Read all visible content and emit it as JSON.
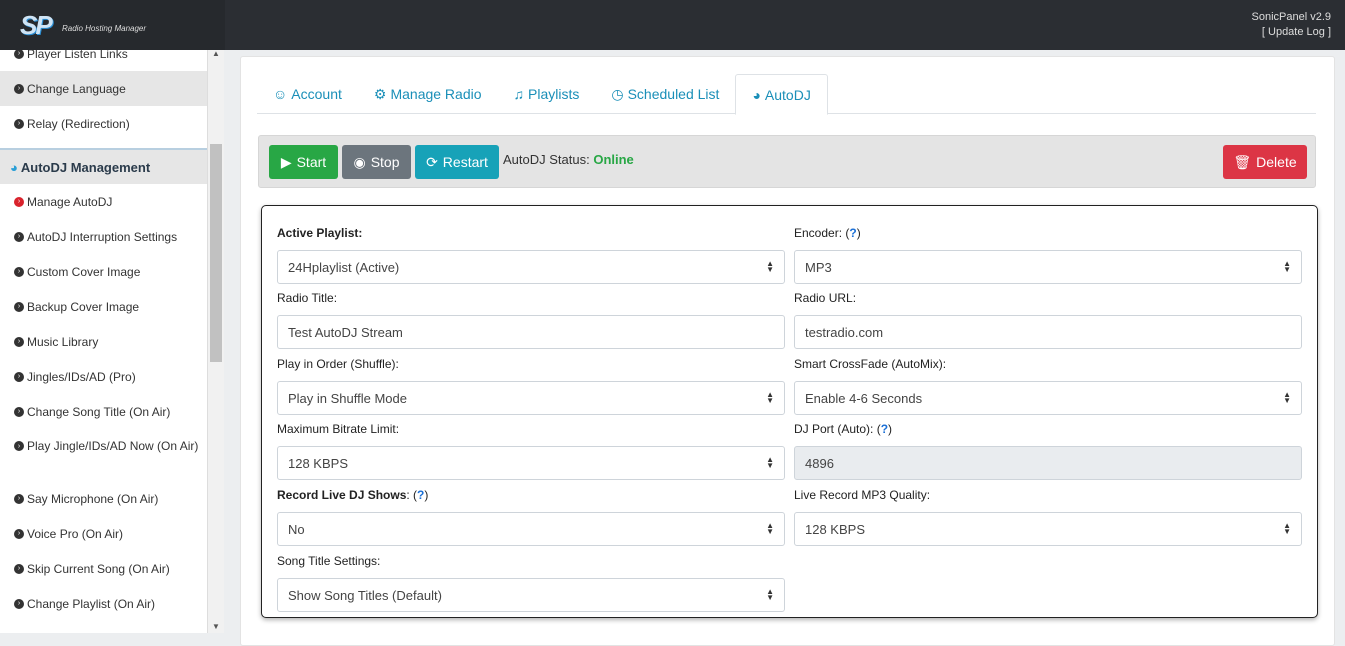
{
  "header": {
    "logo_text": "SP",
    "logo_subtitle": "Radio Hosting Manager",
    "version": "SonicPanel v2.9",
    "update_log": "[ Update Log ]"
  },
  "sidebar": {
    "items_top": [
      {
        "label": "Player Listen Links"
      },
      {
        "label": "Change Language"
      },
      {
        "label": "Relay (Redirection)"
      }
    ],
    "section": "AutoDJ Management",
    "items": [
      {
        "label": "Manage AutoDJ",
        "active": true
      },
      {
        "label": "AutoDJ Interruption Settings"
      },
      {
        "label": "Custom Cover Image"
      },
      {
        "label": "Backup Cover Image"
      },
      {
        "label": "Music Library"
      },
      {
        "label": "Jingles/IDs/AD (Pro)"
      },
      {
        "label": "Change Song Title (On Air)"
      },
      {
        "label": "Play Jingle/IDs/AD Now (On Air)"
      },
      {
        "label": "Say Microphone (On Air)"
      },
      {
        "label": "Voice Pro (On Air)"
      },
      {
        "label": "Skip Current Song (On Air)"
      },
      {
        "label": "Change Playlist (On Air)"
      }
    ]
  },
  "tabs": [
    {
      "label": "Account",
      "icon": "user-circle-icon"
    },
    {
      "label": "Manage Radio",
      "icon": "gear-icon"
    },
    {
      "label": "Playlists",
      "icon": "music-icon"
    },
    {
      "label": "Scheduled List",
      "icon": "clock-icon"
    },
    {
      "label": "AutoDJ",
      "icon": "headphones-icon",
      "active": true
    }
  ],
  "actions": {
    "start": "Start",
    "stop": "Stop",
    "restart": "Restart",
    "delete": "Delete",
    "status_label": "AutoDJ Status:",
    "status_value": "Online"
  },
  "colors": {
    "start": "#28a745",
    "stop": "#6c757d",
    "restart": "#17a2b8",
    "delete": "#dc3545",
    "online": "#28a745",
    "tab": "#1a8fb8"
  },
  "form": {
    "active_playlist": {
      "label": "Active Playlist",
      "value": "24Hplaylist (Active)"
    },
    "encoder": {
      "label": "Encoder:",
      "value": "MP3"
    },
    "radio_title": {
      "label": "Radio Title:",
      "value": "Test AutoDJ Stream"
    },
    "radio_url": {
      "label": "Radio URL:",
      "value": "testradio.com"
    },
    "play_order": {
      "label": "Play in Order (Shuffle):",
      "value": "Play in Shuffle Mode"
    },
    "crossfade": {
      "label": "Smart CrossFade (AutoMix):",
      "value": "Enable 4-6 Seconds"
    },
    "max_bitrate": {
      "label": "Maximum Bitrate Limit:",
      "value": "128 KBPS"
    },
    "dj_port": {
      "label": "DJ Port (Auto):",
      "value": "4896"
    },
    "record_live": {
      "label": "Record Live DJ Shows",
      "value": "No"
    },
    "record_quality": {
      "label": "Live Record MP3 Quality:",
      "value": "128 KBPS"
    },
    "song_title": {
      "label": "Song Title Settings:",
      "value": "Show Song Titles (Default)"
    },
    "help": "?"
  }
}
